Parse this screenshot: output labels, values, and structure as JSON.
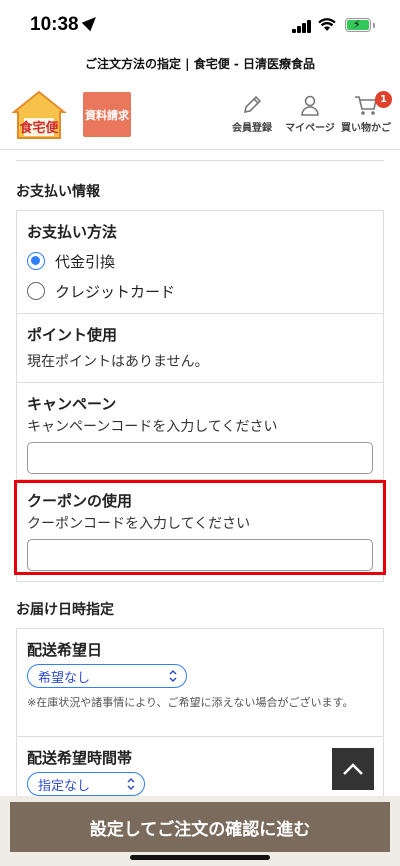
{
  "status_bar": {
    "time": "10:38"
  },
  "page_title": "ご注文方法の指定 | 食宅便 - 日清医療食品",
  "header": {
    "logo_text": "食宅便",
    "request_button": "資料請求",
    "member_register": "会員登録",
    "my_page": "マイページ",
    "cart": "買い物かご",
    "cart_count": "1"
  },
  "payment": {
    "section_title": "お支払い情報",
    "method_title": "お支払い方法",
    "options": [
      "代金引換",
      "クレジットカード"
    ],
    "selected_option": "代金引換",
    "points_title": "ポイント使用",
    "points_text": "現在ポイントはありません。",
    "campaign_title": "キャンペーン",
    "campaign_hint": "キャンペーンコードを入力してください",
    "campaign_value": "",
    "coupon_title": "クーポンの使用",
    "coupon_hint": "クーポンコードを入力してください",
    "coupon_value": ""
  },
  "delivery": {
    "section_title": "お届け日時指定",
    "date_title": "配送希望日",
    "date_selected": "希望なし",
    "date_note": "※在庫状況や諸事情により、ご希望に添えない場合がございます。",
    "time_title": "配送希望時間帯",
    "time_selected": "指定なし"
  },
  "confirm_button": "設定してご注文の確認に進む",
  "colors": {
    "accent_blue": "#2f7ff7",
    "highlight_red": "#e7000a",
    "confirm_bg": "#7a6b5c",
    "request_bg": "#e8775b"
  }
}
